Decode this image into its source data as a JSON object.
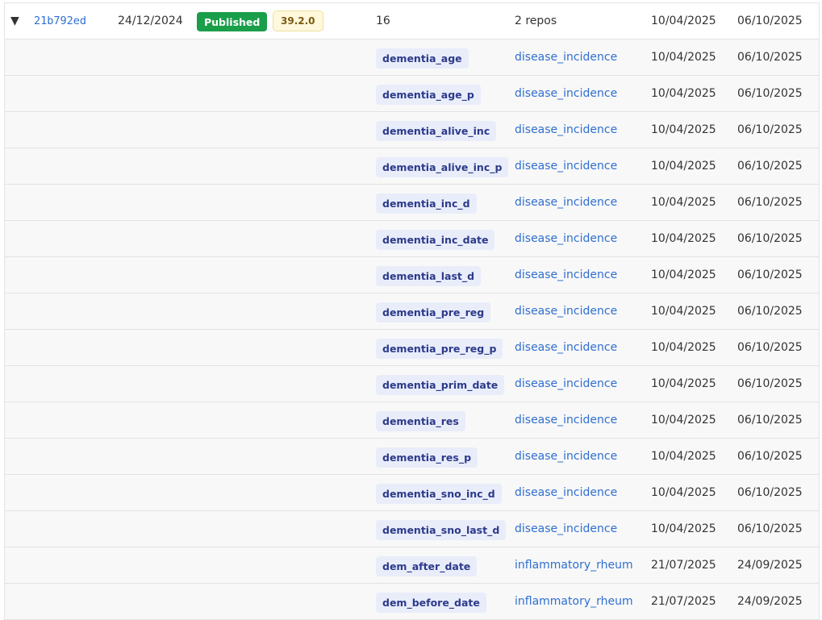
{
  "version_row": {
    "toggle_icon": "triangle-down",
    "hash": "21b792ed",
    "created": "24/12/2024",
    "status": "Published",
    "version": "39.2.0",
    "count": "16",
    "repos": "2 repos",
    "date1": "10/04/2025",
    "date2": "06/10/2025",
    "colors": {
      "published": "#1a9e4a",
      "version_bg": "#fff8dc",
      "link": "#2f6fd0",
      "tag_bg": "#e9edfa"
    }
  },
  "variables": [
    {
      "name": "dementia_age",
      "repo": "disease_incidence",
      "date1": "10/04/2025",
      "date2": "06/10/2025"
    },
    {
      "name": "dementia_age_p",
      "repo": "disease_incidence",
      "date1": "10/04/2025",
      "date2": "06/10/2025"
    },
    {
      "name": "dementia_alive_inc",
      "repo": "disease_incidence",
      "date1": "10/04/2025",
      "date2": "06/10/2025"
    },
    {
      "name": "dementia_alive_inc_p",
      "repo": "disease_incidence",
      "date1": "10/04/2025",
      "date2": "06/10/2025"
    },
    {
      "name": "dementia_inc_d",
      "repo": "disease_incidence",
      "date1": "10/04/2025",
      "date2": "06/10/2025"
    },
    {
      "name": "dementia_inc_date",
      "repo": "disease_incidence",
      "date1": "10/04/2025",
      "date2": "06/10/2025"
    },
    {
      "name": "dementia_last_d",
      "repo": "disease_incidence",
      "date1": "10/04/2025",
      "date2": "06/10/2025"
    },
    {
      "name": "dementia_pre_reg",
      "repo": "disease_incidence",
      "date1": "10/04/2025",
      "date2": "06/10/2025"
    },
    {
      "name": "dementia_pre_reg_p",
      "repo": "disease_incidence",
      "date1": "10/04/2025",
      "date2": "06/10/2025"
    },
    {
      "name": "dementia_prim_date",
      "repo": "disease_incidence",
      "date1": "10/04/2025",
      "date2": "06/10/2025"
    },
    {
      "name": "dementia_res",
      "repo": "disease_incidence",
      "date1": "10/04/2025",
      "date2": "06/10/2025"
    },
    {
      "name": "dementia_res_p",
      "repo": "disease_incidence",
      "date1": "10/04/2025",
      "date2": "06/10/2025"
    },
    {
      "name": "dementia_sno_inc_d",
      "repo": "disease_incidence",
      "date1": "10/04/2025",
      "date2": "06/10/2025"
    },
    {
      "name": "dementia_sno_last_d",
      "repo": "disease_incidence",
      "date1": "10/04/2025",
      "date2": "06/10/2025"
    },
    {
      "name": "dem_after_date",
      "repo": "inflammatory_rheum",
      "date1": "21/07/2025",
      "date2": "24/09/2025"
    },
    {
      "name": "dem_before_date",
      "repo": "inflammatory_rheum",
      "date1": "21/07/2025",
      "date2": "24/09/2025"
    }
  ]
}
